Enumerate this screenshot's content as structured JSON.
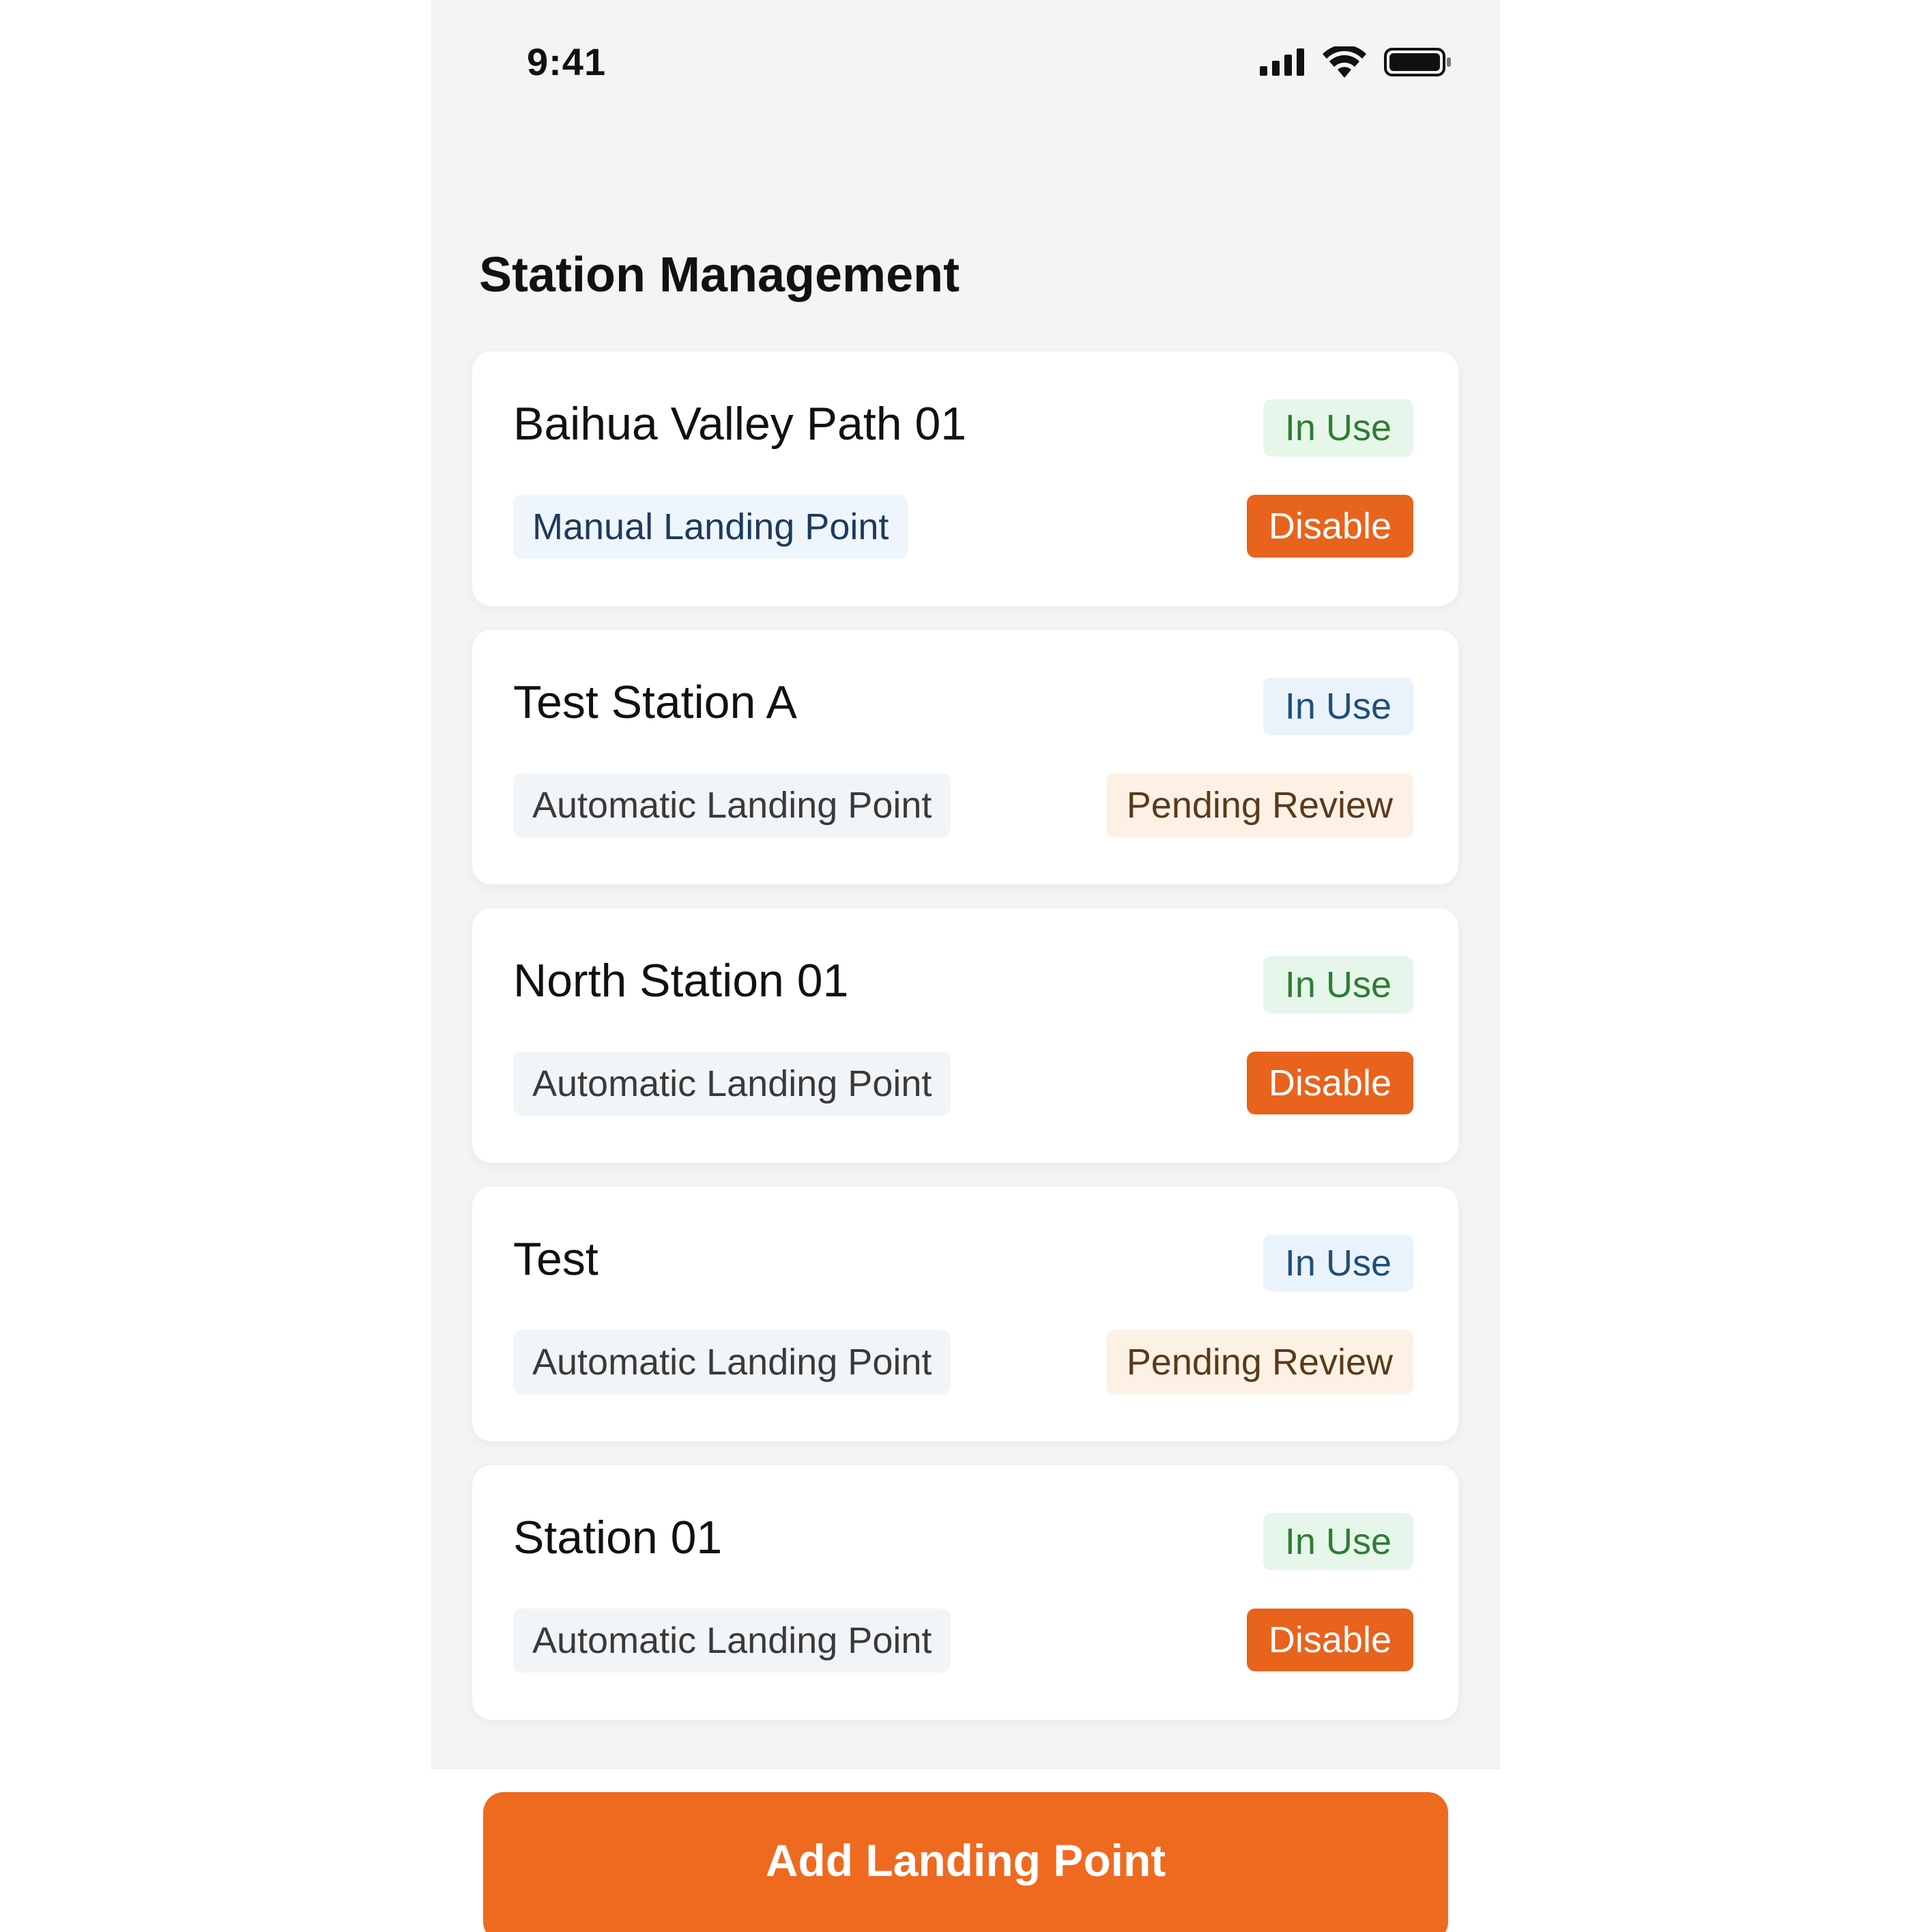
{
  "status_bar": {
    "time": "9:41",
    "icons": [
      "cellular-signal-icon",
      "wifi-icon",
      "battery-icon"
    ]
  },
  "page": {
    "title": "Station Management"
  },
  "stations": [
    {
      "name": "Baihua Valley Path 01",
      "status": "In Use",
      "status_tone": "green",
      "type": "Manual Landing Point",
      "type_tone": "manual",
      "action": "Disable",
      "review": null
    },
    {
      "name": "Test Station A",
      "status": "In Use",
      "status_tone": "blue",
      "type": "Automatic Landing Point",
      "type_tone": "auto",
      "action": null,
      "review": "Pending Review"
    },
    {
      "name": "North Station 01",
      "status": "In Use",
      "status_tone": "green",
      "type": "Automatic Landing Point",
      "type_tone": "auto",
      "action": "Disable",
      "review": null
    },
    {
      "name": "Test",
      "status": "In Use",
      "status_tone": "blue",
      "type": "Automatic Landing Point",
      "type_tone": "auto",
      "action": null,
      "review": "Pending Review"
    },
    {
      "name": "Station 01",
      "status": "In Use",
      "status_tone": "green",
      "type": "Automatic Landing Point",
      "type_tone": "auto",
      "action": "Disable",
      "review": null
    }
  ],
  "footer": {
    "add_label": "Add Landing Point"
  },
  "colors": {
    "accent": "#ee6a1f",
    "disable_button": "#e8631c",
    "in_use_green_bg": "#e6f6ea",
    "in_use_blue_bg": "#eaf3fb",
    "pending_bg": "#fdf1e5",
    "page_bg": "#f4f4f4"
  }
}
